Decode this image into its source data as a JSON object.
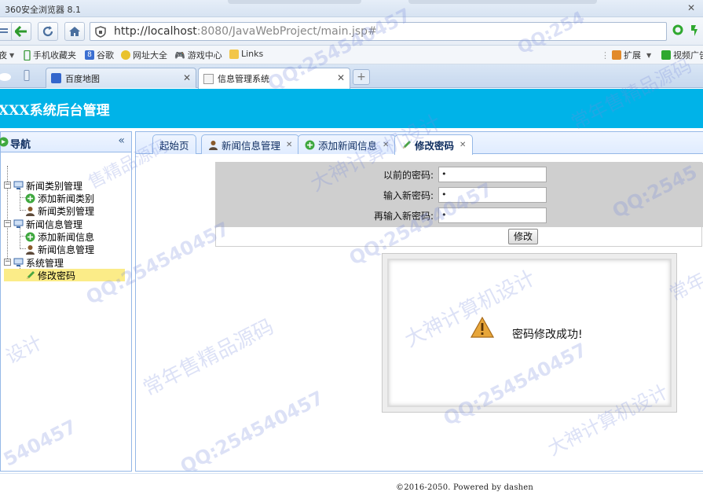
{
  "browser": {
    "window_title": "360安全浏览器 8.1",
    "url_host": "http://localhost",
    "url_rest": ":8080/JavaWebProject/main.jsp#",
    "favorites": [
      {
        "label": "夜"
      },
      {
        "label": "手机收藏夹"
      },
      {
        "label": "谷歌"
      },
      {
        "label": "网址大全"
      },
      {
        "label": "游戏中心"
      },
      {
        "label": "Links"
      }
    ],
    "right_items": {
      "extend": "扩展",
      "video": "视频广告"
    },
    "tabs": [
      {
        "label": "百度地图"
      },
      {
        "label": "信息管理系统"
      }
    ],
    "new_tab": "+"
  },
  "app": {
    "title": "XXX系统后台管理"
  },
  "sidebar": {
    "title": "导航",
    "collapse_glyph": "«",
    "tree": [
      {
        "label": "新闻类别管理"
      },
      {
        "label": "添加新闻类别"
      },
      {
        "label": "新闻类别管理"
      },
      {
        "label": "新闻信息管理"
      },
      {
        "label": "添加新闻信息"
      },
      {
        "label": "新闻信息管理"
      },
      {
        "label": "系统管理"
      },
      {
        "label": "修改密码"
      }
    ]
  },
  "page_tabs": [
    {
      "label": "起始页"
    },
    {
      "label": "新闻信息管理"
    },
    {
      "label": "添加新闻信息"
    },
    {
      "label": "修改密码"
    }
  ],
  "form": {
    "old_label": "以前的密码:",
    "old_value": "•",
    "new_label": "输入新密码:",
    "new_value": "•",
    "confirm_label": "再输入新密码:",
    "confirm_value": "•",
    "submit_label": "修改"
  },
  "dialog": {
    "message": "密码修改成功!"
  },
  "footer": {
    "text": "©2016-2050. Powered by dashen"
  },
  "watermarks": {
    "qq": "QQ:254540457",
    "design": "大神计算机设计",
    "source": "常年售精品源码",
    "frag_qq1": "QQ:254",
    "frag_qq2": "QQ:2545",
    "frag_qq3": "540457",
    "frag_design": "设计",
    "frag_source": "常年",
    "frag_source2": "售精品源码"
  },
  "colors": {
    "header": "#00b3e8",
    "selected_node": "#fbec88",
    "border": "#95b8e7"
  }
}
